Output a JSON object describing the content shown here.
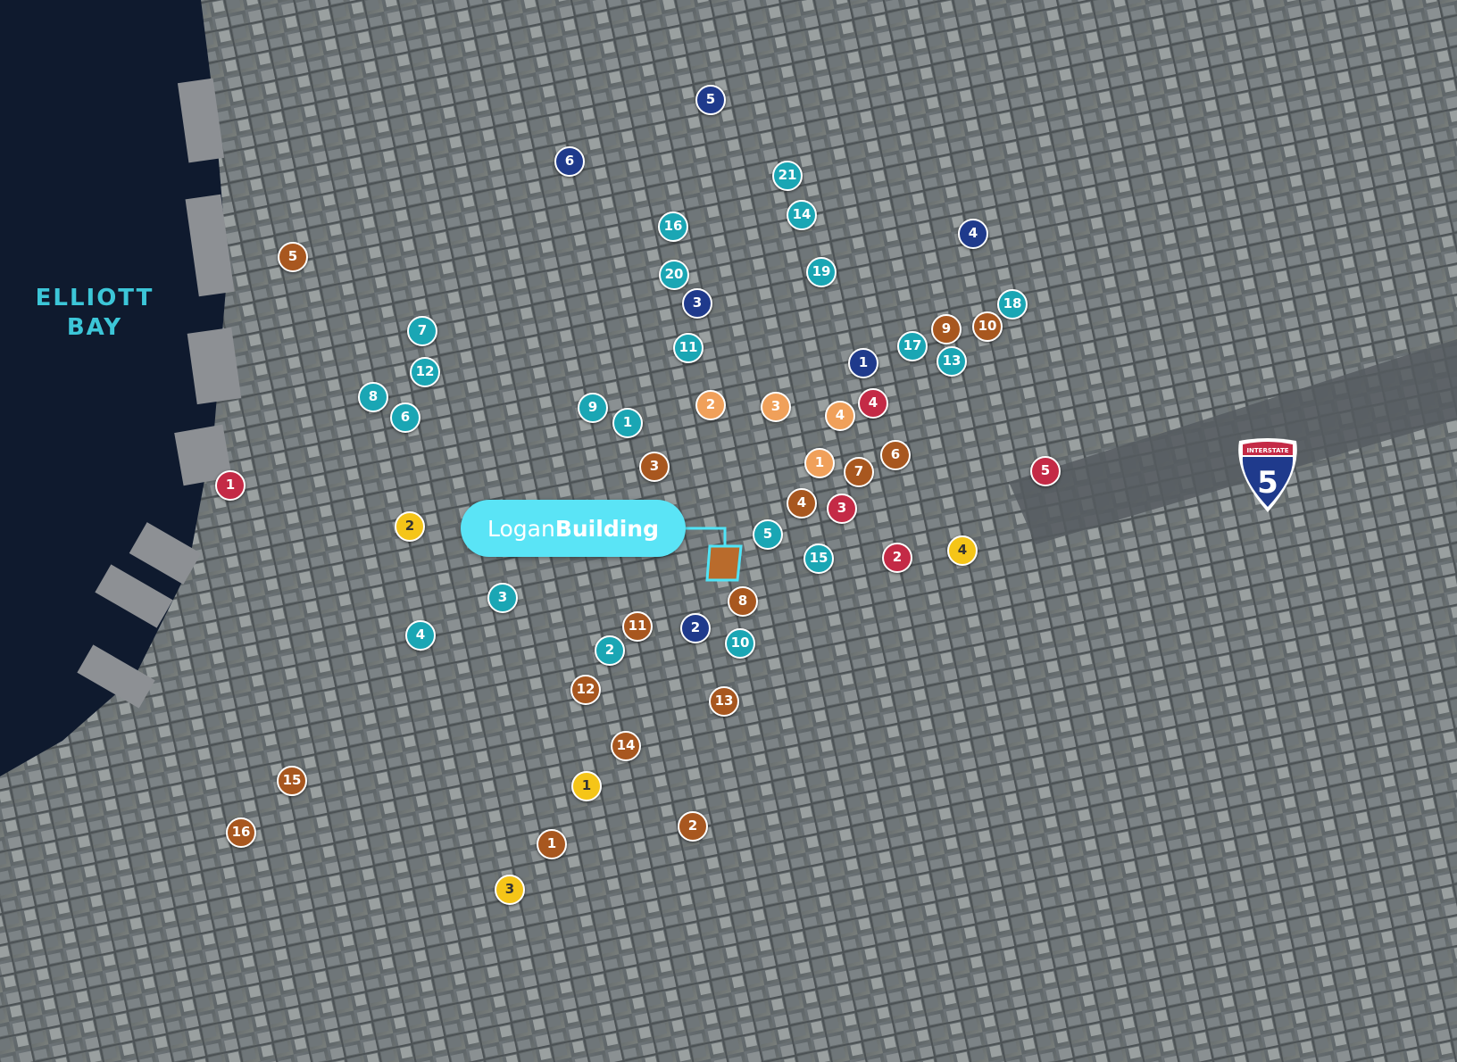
{
  "colors": {
    "teal": "#1aa6b4",
    "navy": "#1f3a8c",
    "brown": "#a8571f",
    "orange": "#f0a05a",
    "red": "#c42a46",
    "yellow": "#f5c518",
    "accent": "#4fe4f7"
  },
  "water_label": {
    "line1": "ELLIOTT",
    "line2": "BAY"
  },
  "callout": {
    "part1": "Logan",
    "part2": "Building"
  },
  "highway_shield": {
    "top_text": "INTERSTATE",
    "number": "5"
  },
  "markers": [
    {
      "label": "5",
      "color": "navy"
    },
    {
      "label": "6",
      "color": "navy"
    },
    {
      "label": "3",
      "color": "navy"
    },
    {
      "label": "4",
      "color": "navy"
    },
    {
      "label": "1",
      "color": "navy"
    },
    {
      "label": "2",
      "color": "navy"
    },
    {
      "label": "21",
      "color": "teal"
    },
    {
      "label": "14",
      "color": "teal"
    },
    {
      "label": "16",
      "color": "teal"
    },
    {
      "label": "20",
      "color": "teal"
    },
    {
      "label": "19",
      "color": "teal"
    },
    {
      "label": "18",
      "color": "teal"
    },
    {
      "label": "11",
      "color": "teal"
    },
    {
      "label": "17",
      "color": "teal"
    },
    {
      "label": "13",
      "color": "teal"
    },
    {
      "label": "7",
      "color": "teal"
    },
    {
      "label": "12",
      "color": "teal"
    },
    {
      "label": "8",
      "color": "teal"
    },
    {
      "label": "6",
      "color": "teal"
    },
    {
      "label": "9",
      "color": "teal"
    },
    {
      "label": "1",
      "color": "teal"
    },
    {
      "label": "5",
      "color": "teal"
    },
    {
      "label": "15",
      "color": "teal"
    },
    {
      "label": "3",
      "color": "teal"
    },
    {
      "label": "4",
      "color": "teal"
    },
    {
      "label": "2",
      "color": "teal"
    },
    {
      "label": "10",
      "color": "teal"
    },
    {
      "label": "5",
      "color": "brown"
    },
    {
      "label": "9",
      "color": "brown"
    },
    {
      "label": "10",
      "color": "brown"
    },
    {
      "label": "3",
      "color": "brown"
    },
    {
      "label": "7",
      "color": "brown"
    },
    {
      "label": "6",
      "color": "brown"
    },
    {
      "label": "4",
      "color": "brown"
    },
    {
      "label": "8",
      "color": "brown"
    },
    {
      "label": "11",
      "color": "brown"
    },
    {
      "label": "12",
      "color": "brown"
    },
    {
      "label": "13",
      "color": "brown"
    },
    {
      "label": "14",
      "color": "brown"
    },
    {
      "label": "15",
      "color": "brown"
    },
    {
      "label": "16",
      "color": "brown"
    },
    {
      "label": "2",
      "color": "brown"
    },
    {
      "label": "1",
      "color": "brown"
    },
    {
      "label": "2",
      "color": "orange"
    },
    {
      "label": "3",
      "color": "orange"
    },
    {
      "label": "4",
      "color": "orange"
    },
    {
      "label": "1",
      "color": "orange"
    },
    {
      "label": "4",
      "color": "red"
    },
    {
      "label": "1",
      "color": "red"
    },
    {
      "label": "5",
      "color": "red"
    },
    {
      "label": "3",
      "color": "red"
    },
    {
      "label": "2",
      "color": "red"
    },
    {
      "label": "2",
      "color": "yellow"
    },
    {
      "label": "4",
      "color": "yellow"
    },
    {
      "label": "1",
      "color": "yellow"
    },
    {
      "label": "3",
      "color": "yellow"
    }
  ]
}
